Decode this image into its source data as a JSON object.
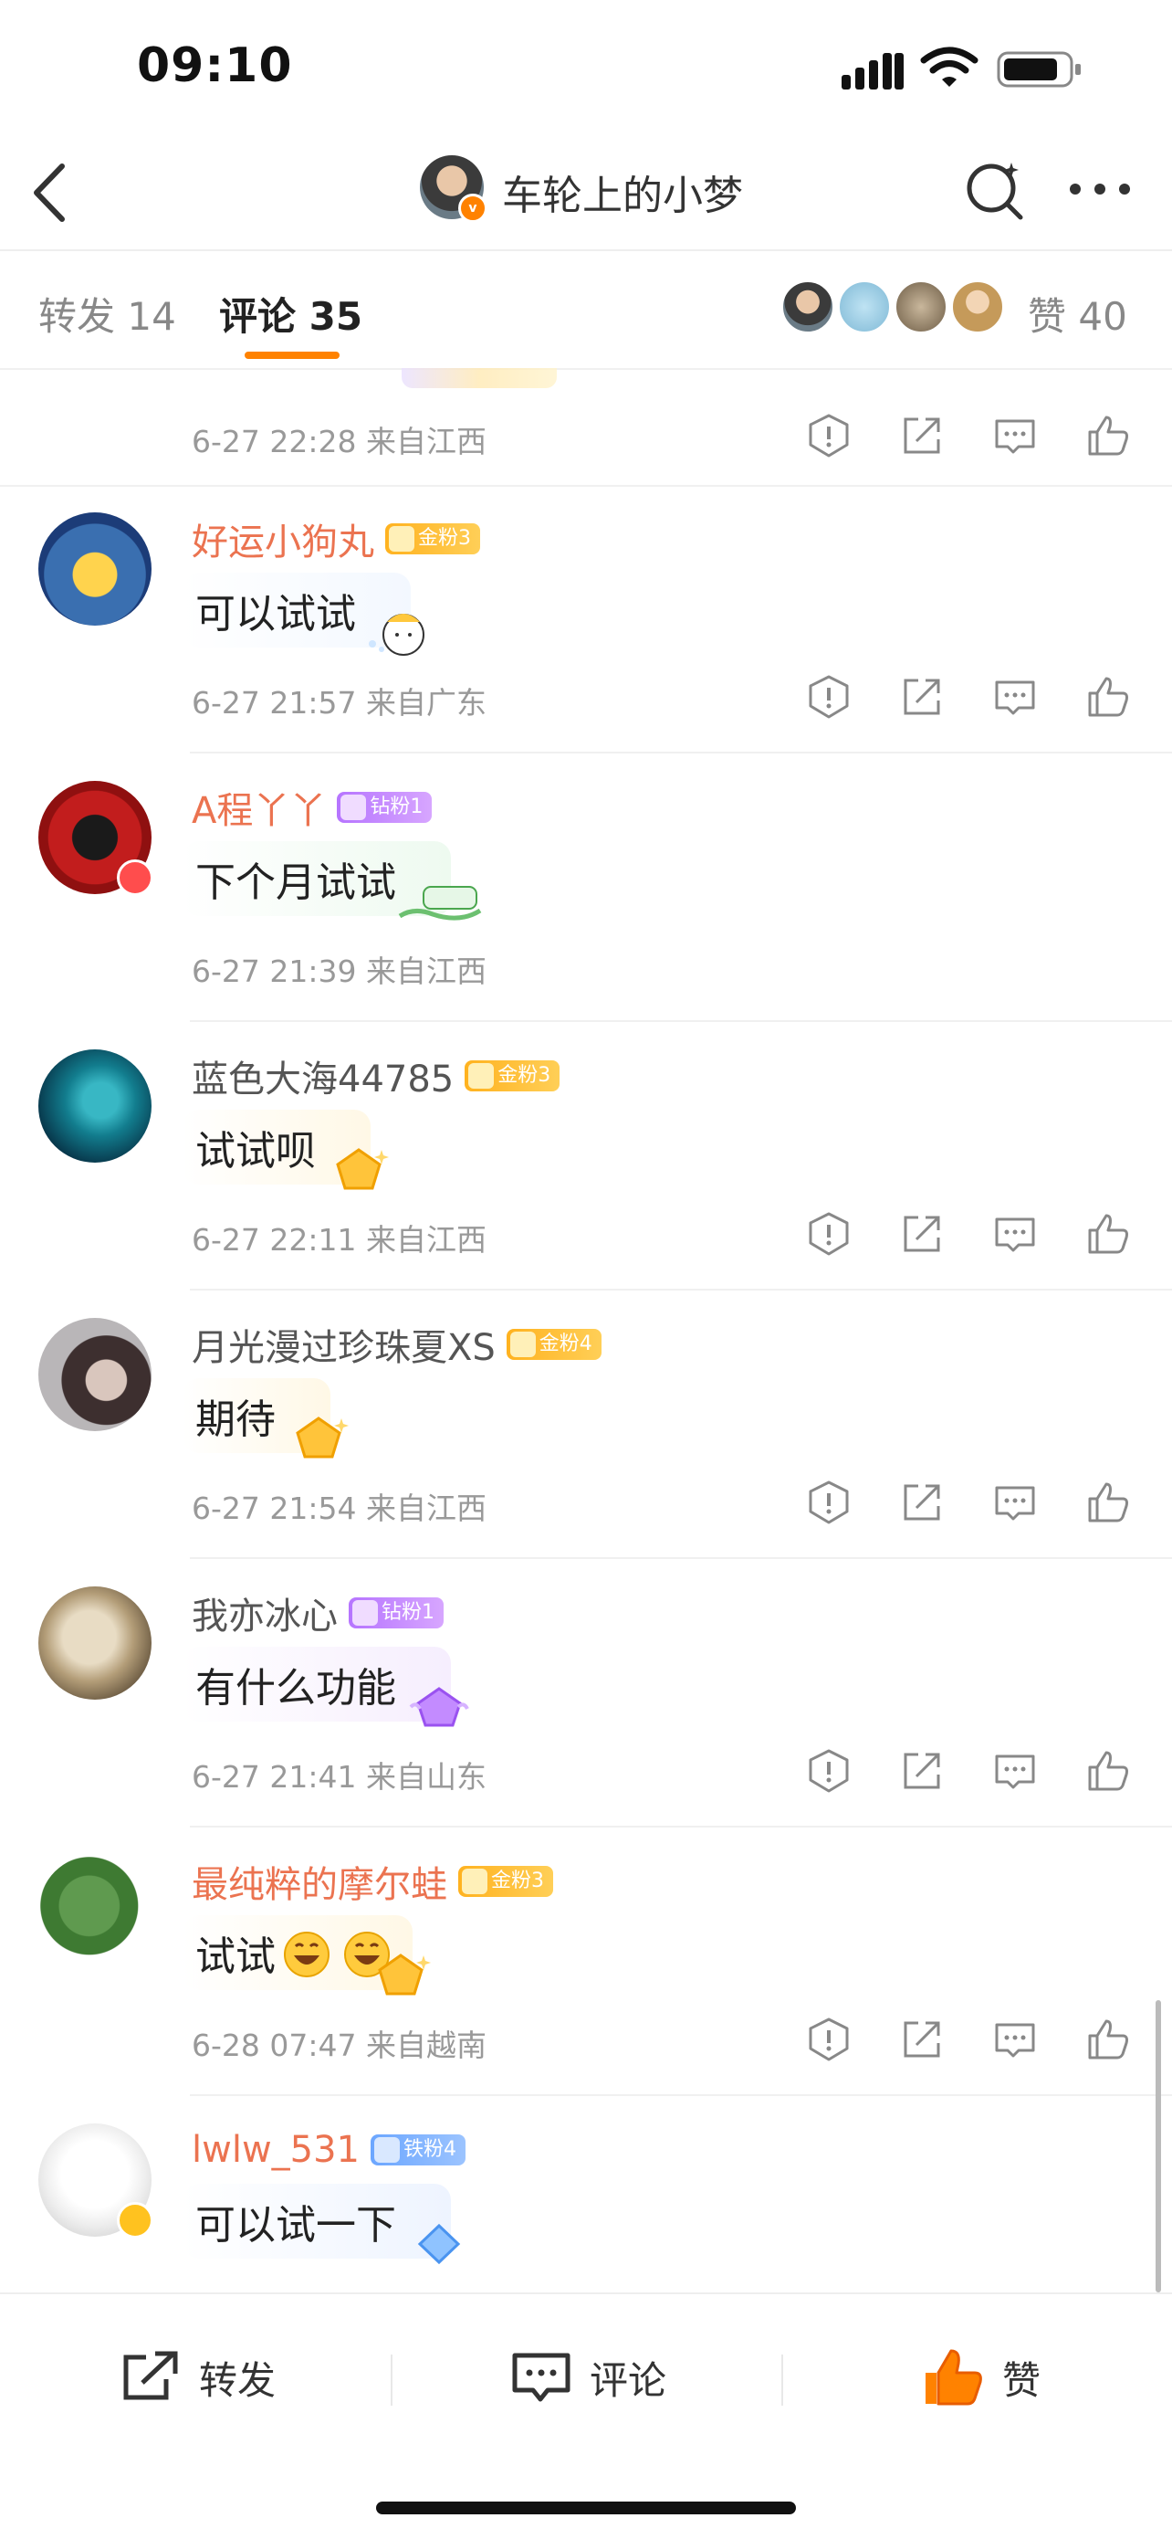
{
  "status_bar": {
    "time": "09:10"
  },
  "nav": {
    "title": "车轮上的小梦"
  },
  "tabs": {
    "forward_label": "转发",
    "forward_count": "14",
    "comment_label": "评论",
    "comment_count": "35",
    "likes_label": "赞",
    "likes_count": "40"
  },
  "first_row": {
    "meta": "6-27 22:28  来自江西"
  },
  "comments": [
    {
      "name": "好运小狗丸",
      "fan_badge": "金粉3",
      "text": "可以试试",
      "meta": "6-27 21:57  来自广东"
    },
    {
      "name": "A程丫丫",
      "fan_badge": "钻粉1",
      "text": "下个月试试",
      "meta": "6-27 21:39  来自江西"
    },
    {
      "name": "蓝色大海44785",
      "fan_badge": "金粉3",
      "text": "试试呗",
      "meta": "6-27 22:11  来自江西"
    },
    {
      "name": "月光漫过珍珠夏XS",
      "fan_badge": "金粉4",
      "text": "期待",
      "meta": "6-27 21:54  来自江西"
    },
    {
      "name": "我亦冰心",
      "fan_badge": "钻粉1",
      "text": "有什么功能",
      "meta": "6-27 21:41  来自山东"
    },
    {
      "name": "最纯粹的摩尔蛙",
      "fan_badge": "金粉3",
      "text": "试试",
      "meta": "6-28 07:47  来自越南"
    },
    {
      "name": "lwlw_531",
      "fan_badge": "铁粉4",
      "text": "可以试一下"
    }
  ],
  "bottom_bar": {
    "forward": "转发",
    "comment": "评论",
    "like": "赞"
  },
  "colors": {
    "accent": "#ff8200",
    "username_orange": "#eb7350",
    "meta_gray": "#999999"
  }
}
